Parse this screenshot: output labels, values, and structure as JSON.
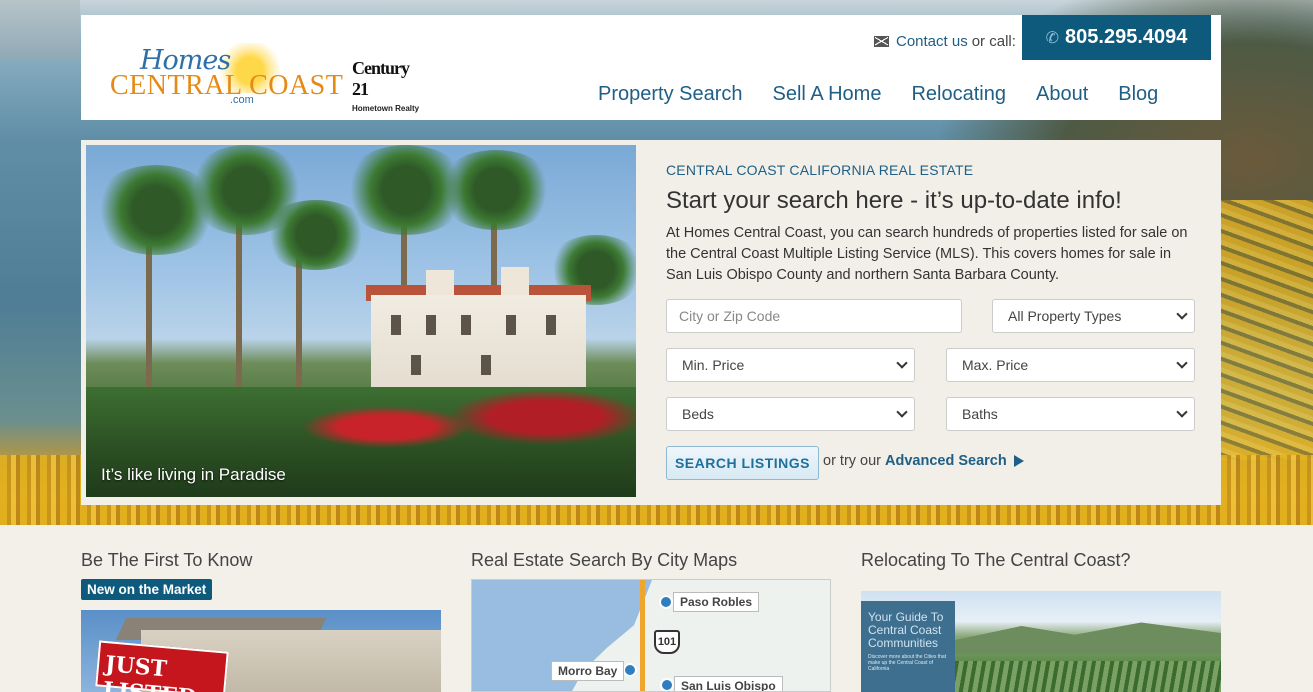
{
  "header": {
    "logo": {
      "homes": "Homes",
      "central_coast": "CENTRAL COAST",
      "com": ".com"
    },
    "partner_logo": {
      "word": "Century 21",
      "sub": "Hometown Realty"
    },
    "contact_label": "Contact us",
    "or_call": "or call:",
    "phone": "805.295.4094",
    "nav": [
      "Property Search",
      "Sell A Home",
      "Relocating",
      "About",
      "Blog"
    ],
    "colors": {
      "brand_blue": "#0e5a7c",
      "link_blue": "#1f5f85",
      "logo_orange": "#e58a16"
    }
  },
  "hero": {
    "photo_caption": "It’s like living in Paradise",
    "eyebrow": "CENTRAL COAST CALIFORNIA REAL ESTATE",
    "headline": "Start your search here - it’s up-to-date info!",
    "intro": "At Homes Central Coast, you can search hundreds of properties listed for sale on the Central Coast Multiple Listing Service (MLS). This covers homes for sale in San Luis Obispo County and northern Santa Barbara County.",
    "search": {
      "city_placeholder": "City or Zip Code",
      "property_types": "All Property Types",
      "min_price": "Min. Price",
      "max_price": "Max. Price",
      "beds": "Beds",
      "baths": "Baths",
      "button": "SEARCH LISTINGS",
      "or_try": "or try our",
      "advanced": "Advanced Search"
    }
  },
  "sections": {
    "first_to_know": {
      "title": "Be The First To Know",
      "badge": "New on the Market",
      "sign_text": "JUST LISTED"
    },
    "city_maps": {
      "title": "Real Estate Search By City Maps",
      "labels": [
        "Paso Robles",
        "Morro Bay",
        "San Luis Obispo"
      ],
      "highway": "101"
    },
    "relocating": {
      "title": "Relocating To The Central Coast?",
      "book_title": "Your Guide To Central Coast Communities",
      "book_sub": "Discover more about the Cities that make up the Central Coast of California"
    }
  }
}
